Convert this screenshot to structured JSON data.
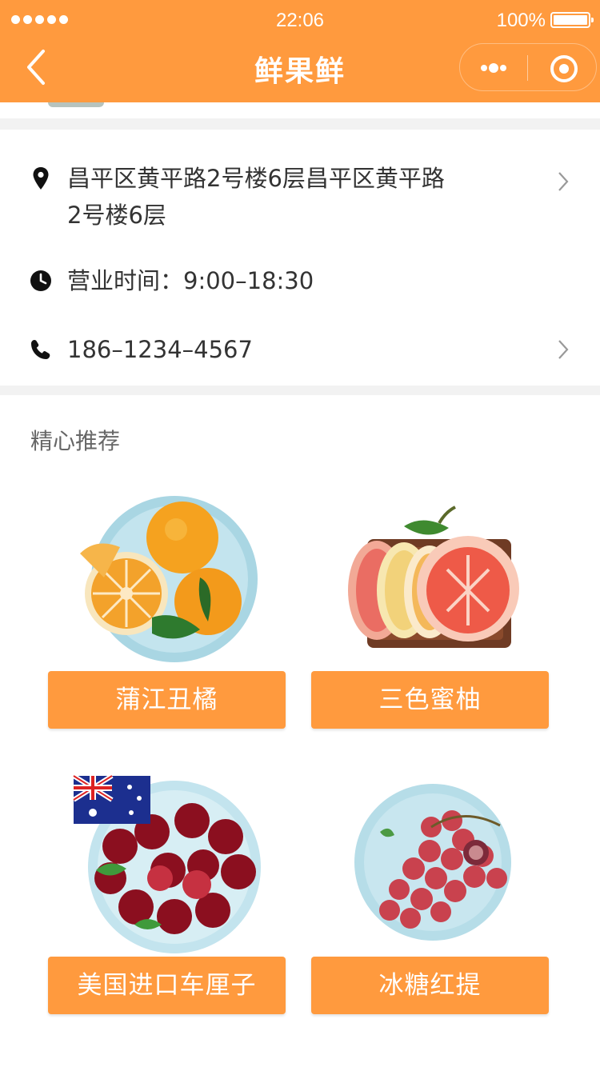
{
  "status_bar": {
    "time": "22:06",
    "battery": "100%"
  },
  "navbar": {
    "title": "鲜果鲜"
  },
  "info": {
    "address_line1": "昌平区黄平路2号楼6层昌平区黄平路",
    "address_line2": "2号楼6层",
    "hours": "营业时间：9:00–18:30",
    "phone": "186–1234–4567"
  },
  "section": {
    "title": "精心推荐"
  },
  "products": [
    {
      "name": "蒲江丑橘"
    },
    {
      "name": "三色蜜柚"
    },
    {
      "name": "美国进口车厘子"
    },
    {
      "name": "冰糖红提"
    }
  ],
  "colors": {
    "accent": "#ff9a3e",
    "background": "#ffffff",
    "divider": "#f2f2f2"
  }
}
